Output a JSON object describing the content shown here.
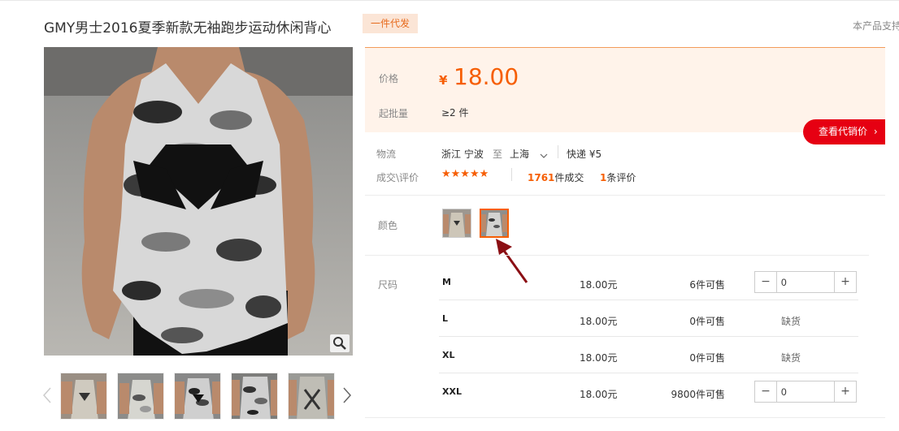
{
  "product": {
    "title": "GMY男士2016夏季新款无袖跑步运动休闲背心",
    "badge": "一件代发",
    "support_text": "本产品支持"
  },
  "price_panel": {
    "price_label": "价格",
    "currency": "¥",
    "price": "18.00",
    "moq_label": "起批量",
    "moq_value": "≥2 件"
  },
  "agent_button": {
    "label": "查看代销价"
  },
  "logistics": {
    "label": "物流",
    "from": "浙江 宁波",
    "to_word": "至",
    "to": "上海",
    "shipping": "快递 ¥5"
  },
  "deals": {
    "label": "成交\\评价",
    "stars": "★★★★★",
    "rating": 5,
    "sold_count": "1761",
    "sold_suffix": "件成交",
    "review_count": "1",
    "review_suffix": "条评价"
  },
  "color": {
    "label": "颜色",
    "selected_index": 1,
    "accent": "#f65e04"
  },
  "sizes": {
    "label": "尺码",
    "rows": [
      {
        "size": "M",
        "price": "18.00元",
        "stock": "6件可售",
        "qty": "0",
        "available": true
      },
      {
        "size": "L",
        "price": "18.00元",
        "stock": "0件可售",
        "status": "缺货",
        "available": false
      },
      {
        "size": "XL",
        "price": "18.00元",
        "stock": "0件可售",
        "status": "缺货",
        "available": false
      },
      {
        "size": "XXL",
        "price": "18.00元",
        "stock": "9800件可售",
        "qty": "0",
        "available": true
      }
    ]
  },
  "stepper": {
    "minus": "−",
    "plus": "+"
  },
  "icons": {
    "zoom": "magnifier-icon",
    "prev": "chevron-left-icon",
    "next": "chevron-right-icon",
    "dropdown": "chevron-down-icon",
    "annotation": "red-arrow-icon"
  },
  "colors": {
    "price_orange": "#f65e04",
    "button_red": "#e60012",
    "panel_bg": "#fff3ea"
  }
}
